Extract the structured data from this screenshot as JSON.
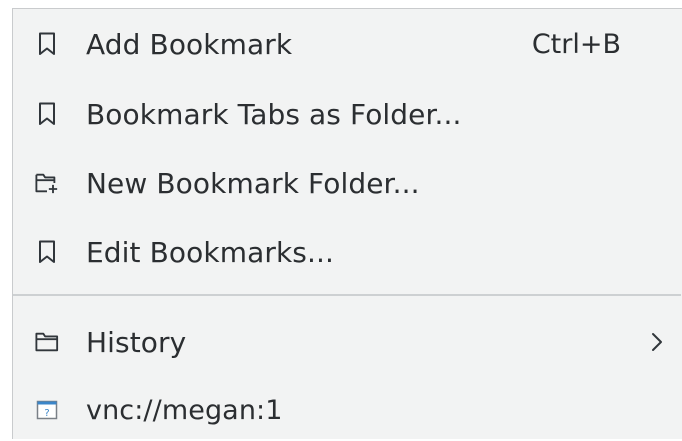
{
  "menu": {
    "items": [
      {
        "label": "Add Bookmark",
        "shortcut": "Ctrl+B",
        "icon": "bookmark-icon"
      },
      {
        "label": "Bookmark Tabs as Folder...",
        "icon": "bookmark-icon"
      },
      {
        "label": "New Bookmark Folder...",
        "icon": "folder-new-icon"
      },
      {
        "label": "Edit Bookmarks...",
        "icon": "bookmark-icon"
      }
    ],
    "history": {
      "label": "History",
      "icon": "folder-icon",
      "submenu_arrow": "chevron-right-icon"
    },
    "vnc": {
      "label": "vnc://megan:1",
      "icon": "unknown-file-icon"
    }
  },
  "colors": {
    "menu_background": "#f2f3f3",
    "text": "#2b2e31",
    "icon": "#31363b",
    "separator": "#cdd0d2",
    "vnc_icon_accent": "#3b86c9"
  }
}
